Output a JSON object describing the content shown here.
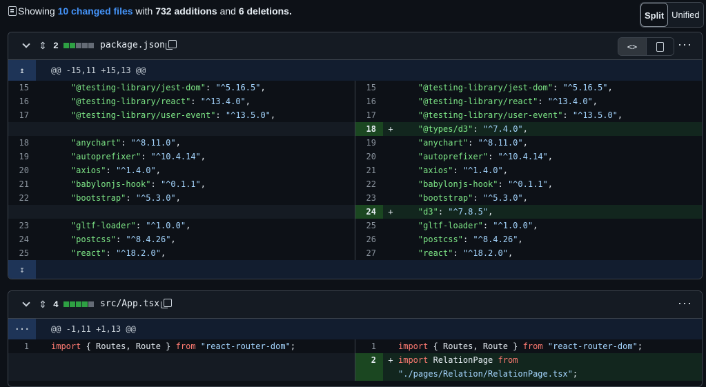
{
  "summary": {
    "prefix": "Showing",
    "files": "10 changed files",
    "mid1": "with",
    "additions": "732 additions",
    "mid2": "and",
    "deletions": "6 deletions."
  },
  "view_toggle": {
    "split": "Split",
    "unified": "Unified"
  },
  "files": [
    {
      "count": "2",
      "name": "package.json",
      "hunk_header": "@@ -15,11 +15,13 @@",
      "left": [
        {
          "n": "15",
          "k": "\"@testing-library/jest-dom\"",
          "v": "\"^5.16.5\""
        },
        {
          "n": "16",
          "k": "\"@testing-library/react\"",
          "v": "\"^13.4.0\""
        },
        {
          "n": "17",
          "k": "\"@testing-library/user-event\"",
          "v": "\"^13.5.0\""
        },
        {
          "n": "",
          "k": "",
          "v": ""
        },
        {
          "n": "18",
          "k": "\"anychart\"",
          "v": "\"^8.11.0\""
        },
        {
          "n": "19",
          "k": "\"autoprefixer\"",
          "v": "\"^10.4.14\""
        },
        {
          "n": "20",
          "k": "\"axios\"",
          "v": "\"^1.4.0\""
        },
        {
          "n": "21",
          "k": "\"babylonjs-hook\"",
          "v": "\"^0.1.1\""
        },
        {
          "n": "22",
          "k": "\"bootstrap\"",
          "v": "\"^5.3.0\""
        },
        {
          "n": "",
          "k": "",
          "v": ""
        },
        {
          "n": "23",
          "k": "\"gltf-loader\"",
          "v": "\"^1.0.0\""
        },
        {
          "n": "24",
          "k": "\"postcss\"",
          "v": "\"^8.4.26\""
        },
        {
          "n": "25",
          "k": "\"react\"",
          "v": "\"^18.2.0\""
        }
      ],
      "right": [
        {
          "n": "15",
          "k": "\"@testing-library/jest-dom\"",
          "v": "\"^5.16.5\""
        },
        {
          "n": "16",
          "k": "\"@testing-library/react\"",
          "v": "\"^13.4.0\""
        },
        {
          "n": "17",
          "k": "\"@testing-library/user-event\"",
          "v": "\"^13.5.0\""
        },
        {
          "n": "18",
          "k": "\"@types/d3\"",
          "v": "\"^7.4.0\"",
          "add": true
        },
        {
          "n": "19",
          "k": "\"anychart\"",
          "v": "\"^8.11.0\""
        },
        {
          "n": "20",
          "k": "\"autoprefixer\"",
          "v": "\"^10.4.14\""
        },
        {
          "n": "21",
          "k": "\"axios\"",
          "v": "\"^1.4.0\""
        },
        {
          "n": "22",
          "k": "\"babylonjs-hook\"",
          "v": "\"^0.1.1\""
        },
        {
          "n": "23",
          "k": "\"bootstrap\"",
          "v": "\"^5.3.0\""
        },
        {
          "n": "24",
          "k": "\"d3\"",
          "v": "\"^7.8.5\"",
          "add": true
        },
        {
          "n": "25",
          "k": "\"gltf-loader\"",
          "v": "\"^1.0.0\""
        },
        {
          "n": "26",
          "k": "\"postcss\"",
          "v": "\"^8.4.26\""
        },
        {
          "n": "27",
          "k": "\"react\"",
          "v": "\"^18.2.0\""
        }
      ]
    },
    {
      "count": "4",
      "name": "src/App.tsx",
      "hunk_header": "@@ -1,11 +1,13 @@",
      "left_line": {
        "n": "1",
        "kw1": "import",
        "p1": " { Routes, Route } ",
        "kw2": "from",
        "s": " \"react-router-dom\"",
        "end": ";"
      },
      "right_line": {
        "n": "1",
        "kw1": "import",
        "p1": " { Routes, Route } ",
        "kw2": "from",
        "s": " \"react-router-dom\"",
        "end": ";"
      },
      "add_line": {
        "n": "2",
        "mark": "+",
        "kw1": "import",
        "p1": " RelationPage ",
        "kw2": "from",
        "s2": "\"./pages/Relation/RelationPage.tsx\"",
        "end": ";"
      }
    }
  ],
  "icons": {
    "hunk_expand_up": "↥",
    "expand_all": "⋯",
    "expand_down": "↧",
    "collapse": "chevron-down-icon",
    "code_view": "<>",
    "more": "···"
  }
}
